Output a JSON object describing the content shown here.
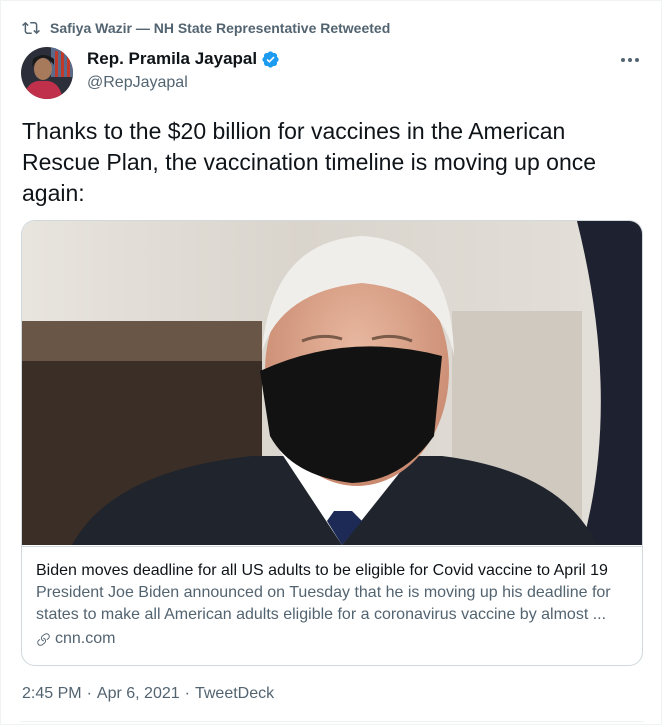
{
  "retweet": {
    "icon": "retweet-icon",
    "text": "Safiya Wazir — NH State Representative Retweeted"
  },
  "author": {
    "display_name": "Rep. Pramila Jayapal",
    "handle": "@RepJayapal",
    "verified": true,
    "verified_color": "#1d9bf0"
  },
  "more_icon": "more-horizontal-icon",
  "tweet": {
    "text": "Thanks to the $20 billion for vaccines in the American Rescue Plan, the vaccination timeline is moving up once again:"
  },
  "card": {
    "title": "Biden moves deadline for all US adults to be eligible for Covid vaccine to April 19",
    "description": "President Joe Biden announced on Tuesday that he is moving up his deadline for states to make all American adults eligible for a coronavirus vaccine by almost ...",
    "domain": "cnn.com",
    "domain_icon": "link-icon"
  },
  "meta": {
    "time": "2:45 PM",
    "separator1": "·",
    "date": "Apr 6, 2021",
    "separator2": "·",
    "source": "TweetDeck"
  }
}
